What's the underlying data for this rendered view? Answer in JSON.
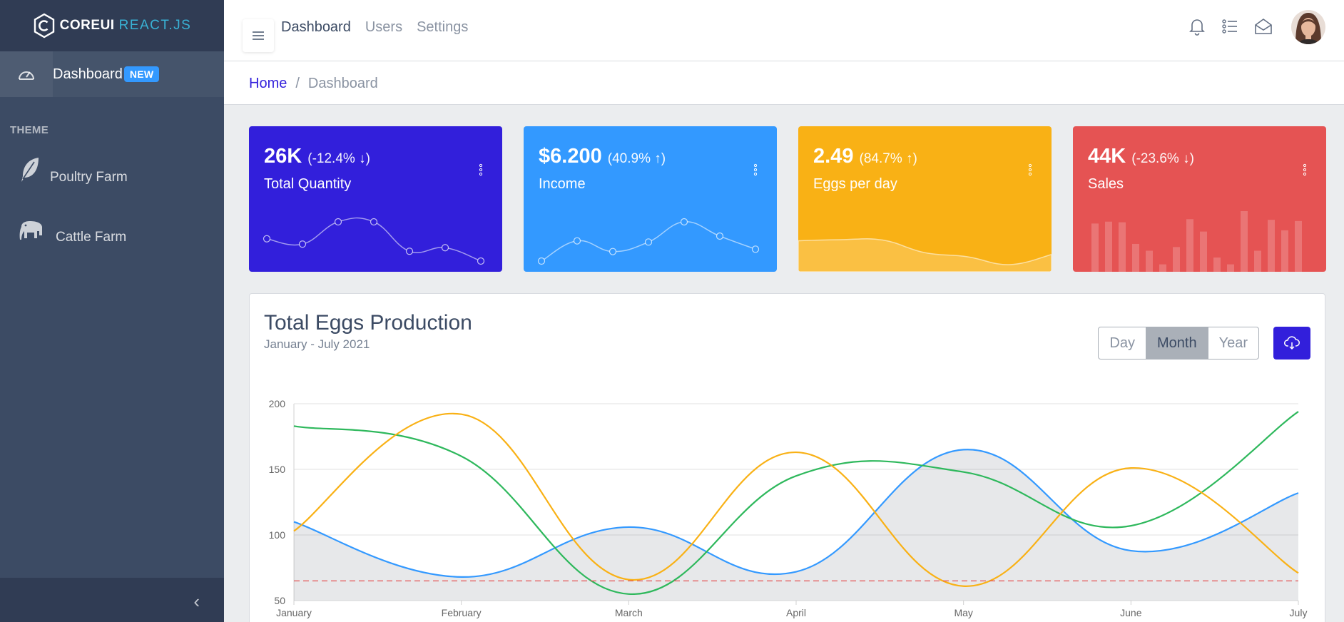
{
  "brand": {
    "core": "COREUI",
    "react": "REACT.JS"
  },
  "sidebar": {
    "dashboard": {
      "label": "Dashboard",
      "badge": "NEW",
      "icon": "speedometer-icon"
    },
    "section_title": "THEME",
    "items": [
      {
        "label": "Poultry Farm",
        "icon": "feather-icon"
      },
      {
        "label": "Cattle Farm",
        "icon": "elephant-icon"
      }
    ],
    "toggler_icon": "chevron-left-icon"
  },
  "header": {
    "nav": [
      "Dashboard",
      "Users",
      "Settings"
    ],
    "icons": [
      "bell-icon",
      "list-icon",
      "envelope-open-icon"
    ]
  },
  "breadcrumb": {
    "home": "Home",
    "separator": "/",
    "current": "Dashboard"
  },
  "widgets": [
    {
      "value": "26K",
      "change": "(-12.4% ↓)",
      "label": "Total Quantity",
      "color": "#321fdb",
      "chart_type": "line",
      "chart_values": [
        65,
        59,
        84,
        84,
        51,
        55,
        40
      ]
    },
    {
      "value": "$6.200",
      "change": "(40.9% ↑)",
      "label": "Income",
      "color": "#3399ff",
      "chart_type": "line",
      "chart_values": [
        1,
        18,
        9,
        17,
        34,
        22,
        11
      ]
    },
    {
      "value": "2.49",
      "change": "(84.7% ↑)",
      "label": "Eggs per day",
      "color": "#f9b115",
      "chart_type": "area",
      "chart_values": [
        78,
        81,
        80,
        45,
        34,
        12,
        40
      ]
    },
    {
      "value": "44K",
      "change": "(-23.6% ↓)",
      "label": "Sales",
      "color": "#e55353",
      "chart_type": "bar",
      "chart_values": [
        78,
        81,
        80,
        45,
        34,
        12,
        40,
        85,
        65,
        23,
        12,
        98,
        34,
        84,
        67,
        82
      ]
    }
  ],
  "main": {
    "title": "Total Eggs Production",
    "subtitle": "January - July 2021",
    "buttons": [
      "Day",
      "Month",
      "Year"
    ],
    "active_button": "Month",
    "download_icon": "cloud-download-icon"
  },
  "chart_data": {
    "type": "line",
    "categories": [
      "January",
      "February",
      "March",
      "April",
      "May",
      "June",
      "July"
    ],
    "ylim": [
      50,
      200
    ],
    "yticks": [
      50,
      100,
      150,
      200
    ],
    "grid": true,
    "series": [
      {
        "values": [
          110,
          68,
          106,
          72,
          165,
          88,
          132
        ],
        "color": "#3399ff",
        "fill": true
      },
      {
        "values": [
          183,
          160,
          55,
          145,
          148,
          107,
          194
        ],
        "color": "#2eb85c",
        "fill": false
      },
      {
        "values": [
          103,
          192,
          66,
          163,
          61,
          151,
          71
        ],
        "color": "#f9b115",
        "fill": false
      },
      {
        "values": [
          65,
          65,
          65,
          65,
          65,
          65,
          65
        ],
        "color": "#e55353",
        "fill": false,
        "dashed": true
      }
    ]
  }
}
